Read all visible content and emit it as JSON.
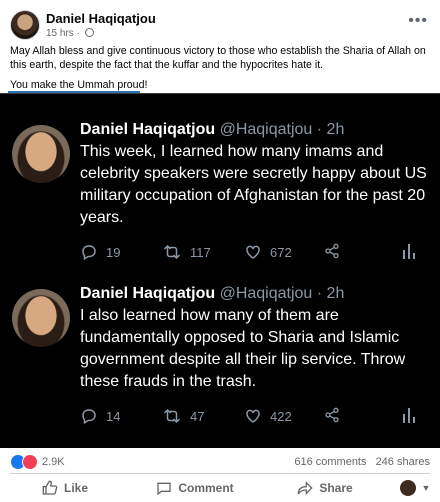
{
  "post": {
    "author": "Daniel Haqiqatjou",
    "time": "15 hrs",
    "separator": "·",
    "text_line1": "May Allah bless and give continuous victory to those who establish the Sharia of Allah on this earth, despite the fact that the kuffar and the hypocrites hate it.",
    "text_line2": "You make the Ummah proud!"
  },
  "tweets": [
    {
      "name": "Daniel Haqiqatjou",
      "handle": "@Haqiqatjou",
      "time": "· 2h",
      "text": "This week, I learned how many imams and celebrity speakers were secretly happy about US military occupation of Afghanistan for the past 20 years.",
      "replies": "19",
      "retweets": "117",
      "likes": "672"
    },
    {
      "name": "Daniel Haqiqatjou",
      "handle": "@Haqiqatjou",
      "time": "· 2h",
      "text": "I also learned how many of them are fundamentally opposed to Sharia and Islamic government despite all their lip service. Throw these frauds in the trash.",
      "replies": "14",
      "retweets": "47",
      "likes": "422"
    }
  ],
  "stats": {
    "reactions": "2.9K",
    "comments": "616 comments",
    "shares": "246 shares"
  },
  "actions": {
    "like": "Like",
    "comment": "Comment",
    "share": "Share"
  },
  "colors": {
    "facebook_blue": "#1877f2",
    "heart_red": "#f33e58",
    "twitter_dark_bg": "#000000",
    "twitter_gray": "#8b98a5"
  },
  "icons": [
    "globe-icon",
    "more-icon",
    "reply-icon",
    "retweet-icon",
    "heart-icon",
    "share-icon",
    "analytics-icon",
    "like-icon",
    "comment-icon",
    "caret-down-icon"
  ]
}
